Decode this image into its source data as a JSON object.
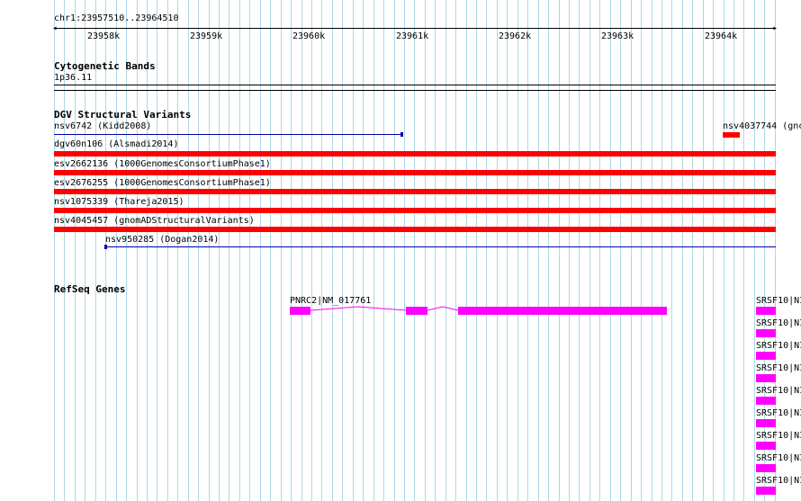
{
  "ruler": {
    "location": "chr1:23957510..23964510",
    "ticks": [
      "23958k",
      "23959k",
      "23960k",
      "23961k",
      "23962k",
      "23963k",
      "23964k"
    ]
  },
  "cyto": {
    "title": "Cytogenetic Bands",
    "band": "1p36.11"
  },
  "dgv": {
    "title": "DGV Structural Variants",
    "features": [
      {
        "label": "nsv6742 (Kidd2008)"
      },
      {
        "label": "nsv4037744 (gnc"
      },
      {
        "label": "dgv60n106 (Alsmadi2014)"
      },
      {
        "label": "esv2662136 (1000GenomesConsortiumPhase1)"
      },
      {
        "label": "esv2676255 (1000GenomesConsortiumPhase1)"
      },
      {
        "label": "nsv1075339 (Thareja2015)"
      },
      {
        "label": "nsv4045457 (gnomADStructuralVariants)"
      },
      {
        "label": "nsv950285 (Dogan2014)"
      }
    ]
  },
  "refseq": {
    "title": "RefSeq Genes",
    "gene": "PNRC2|NM_017761",
    "srsf": [
      "SRSF10|NI",
      "SRSF10|NI",
      "SRSF10|NI",
      "SRSF10|NI",
      "SRSF10|NI",
      "SRSF10|NI",
      "SRSF10|NI",
      "SRSF10|NI",
      "SRSF10|NI"
    ]
  },
  "colors": {
    "grid": "#add8e6",
    "variant": "#ff0000",
    "gene": "#ff00ff",
    "thin": "#0000aa"
  }
}
